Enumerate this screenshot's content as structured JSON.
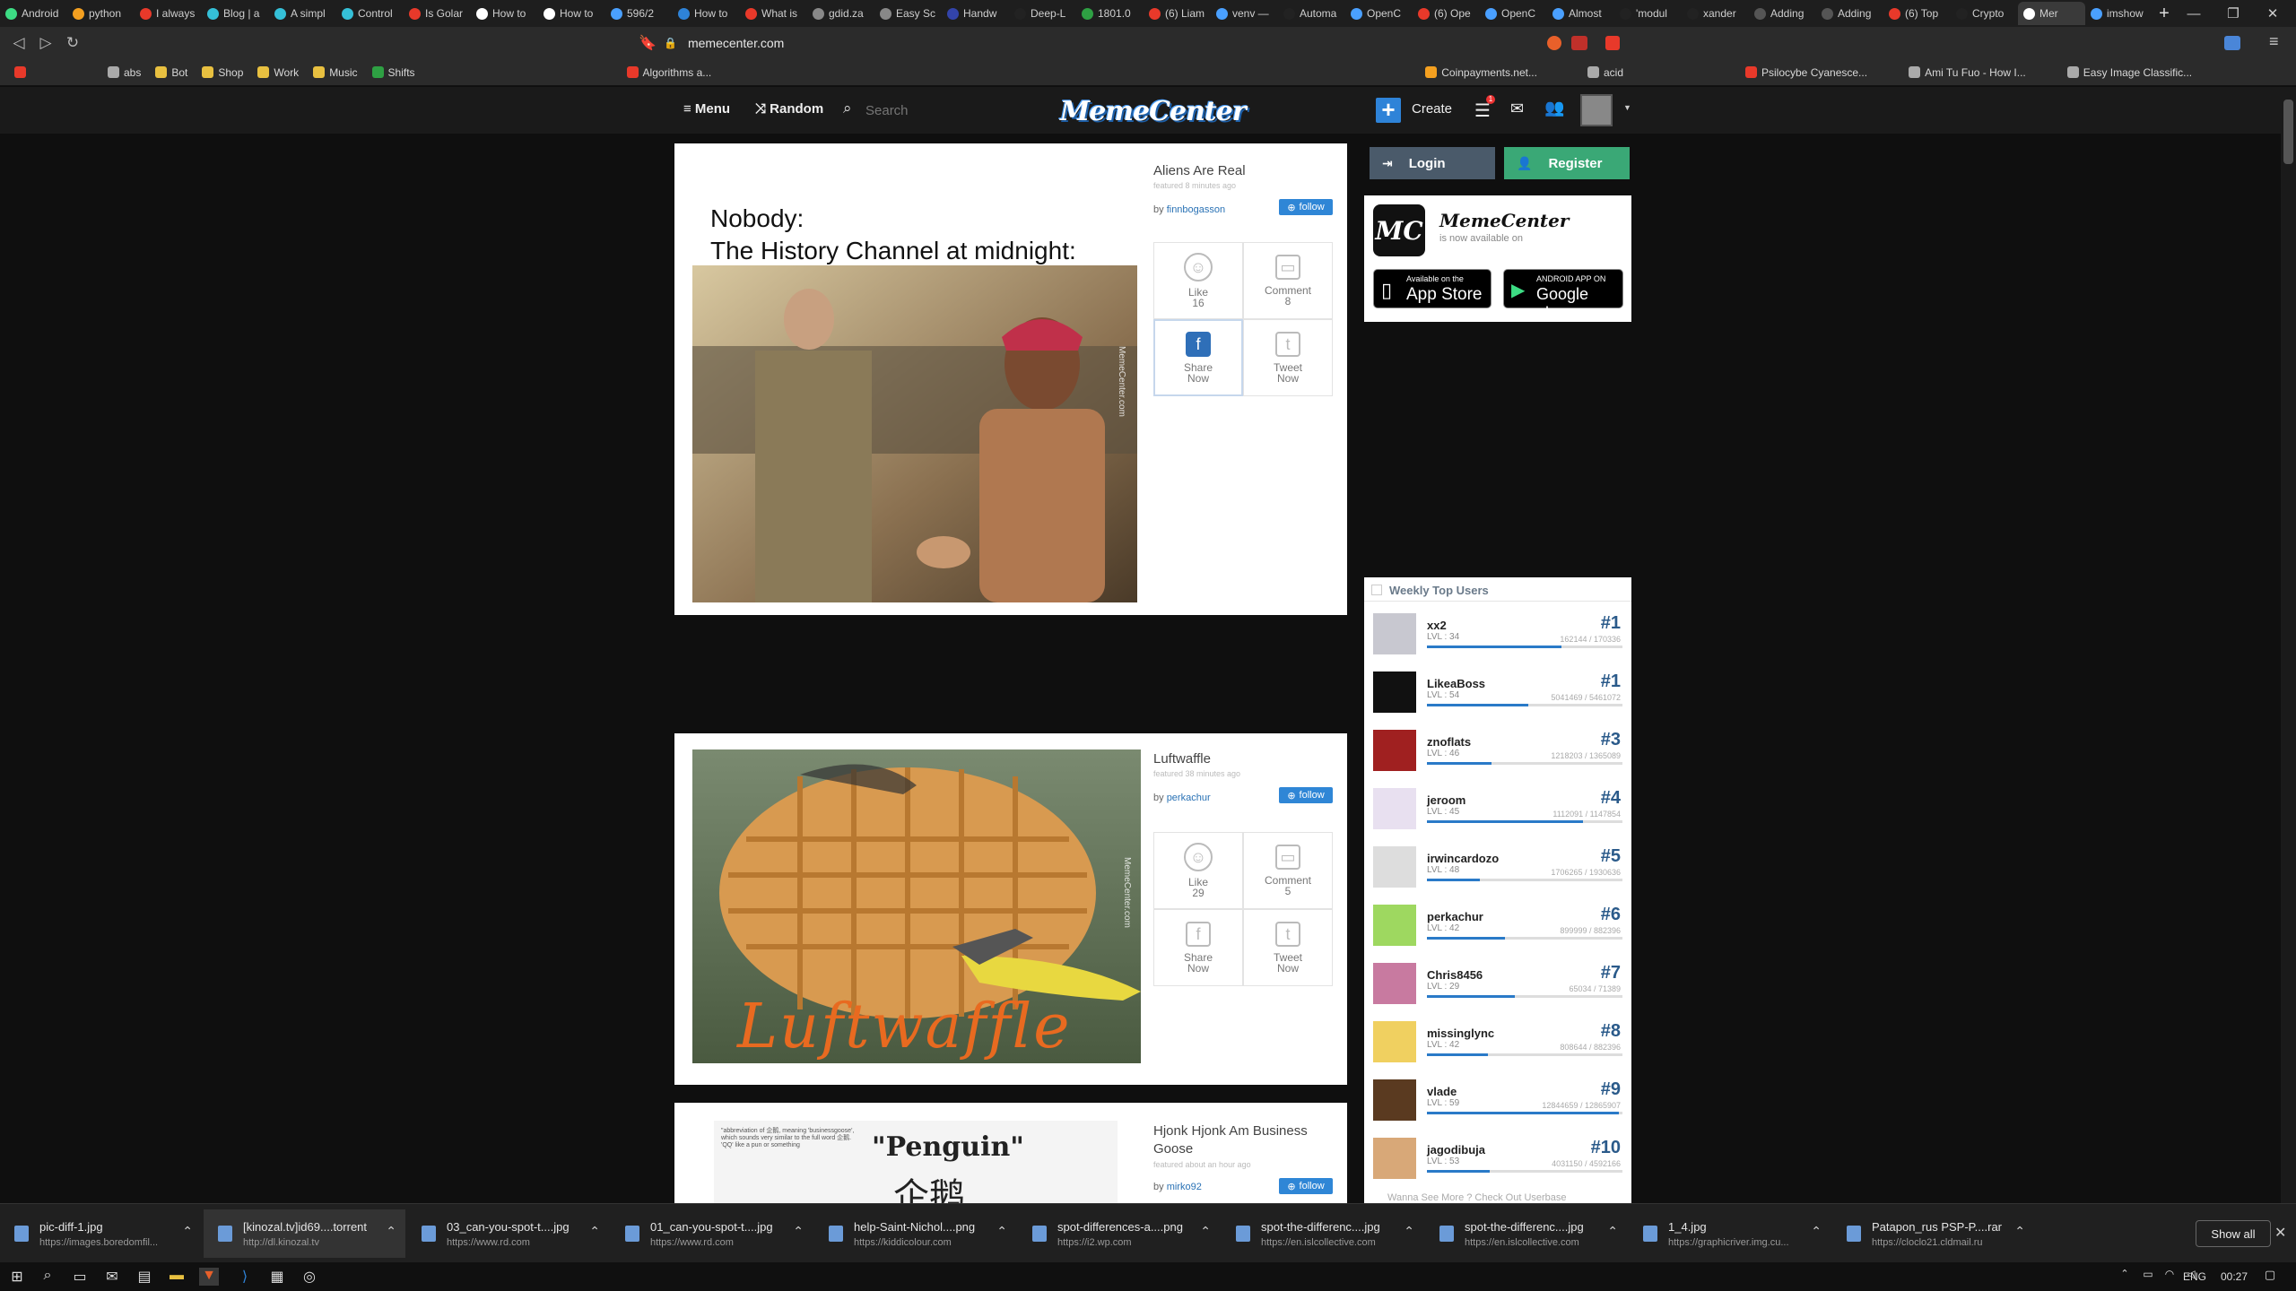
{
  "browser": {
    "tabs": [
      {
        "label": "Android",
        "color": "#3ddc84"
      },
      {
        "label": "python",
        "color": "#f4a020"
      },
      {
        "label": "I always",
        "color": "#e8392a"
      },
      {
        "label": "Blog | a",
        "color": "#35c0d8"
      },
      {
        "label": "A simpl",
        "color": "#35c0d8"
      },
      {
        "label": "Control",
        "color": "#35c0d8"
      },
      {
        "label": "Is Golar",
        "color": "#e8392a"
      },
      {
        "label": "How to",
        "color": "#ffffff"
      },
      {
        "label": "How to",
        "color": "#ffffff"
      },
      {
        "label": "596/2",
        "color": "#4aa0ff"
      },
      {
        "label": "How to",
        "color": "#2e83d8"
      },
      {
        "label": "What is",
        "color": "#e8392a"
      },
      {
        "label": "gdid.za",
        "color": "#888888"
      },
      {
        "label": "Easy Sc",
        "color": "#888888"
      },
      {
        "label": "Handw",
        "color": "#3344aa"
      },
      {
        "label": "Deep-L",
        "color": "#222222"
      },
      {
        "label": "1801.0",
        "color": "#2ea043"
      },
      {
        "label": "(6) Liam",
        "color": "#e8392a"
      },
      {
        "label": "venv —",
        "color": "#4aa0ff"
      },
      {
        "label": "Automa",
        "color": "#222222"
      },
      {
        "label": "OpenC",
        "color": "#4aa0ff"
      },
      {
        "label": "(6) Ope",
        "color": "#e8392a"
      },
      {
        "label": "OpenC",
        "color": "#4aa0ff"
      },
      {
        "label": "Almost",
        "color": "#4aa0ff"
      },
      {
        "label": "'modul",
        "color": "#222222"
      },
      {
        "label": "xander",
        "color": "#222222"
      },
      {
        "label": "Adding",
        "color": "#555555"
      },
      {
        "label": "Adding",
        "color": "#555555"
      },
      {
        "label": "(6) Top",
        "color": "#e8392a"
      },
      {
        "label": "Crypto",
        "color": "#222222"
      },
      {
        "label": "Mer",
        "color": "#ffffff"
      },
      {
        "label": "imshow",
        "color": "#4aa0ff"
      }
    ],
    "active_tab_index": 30,
    "url": "memecenter.com",
    "bookmarks": [
      {
        "label": "abs",
        "color": "#aaaaaa"
      },
      {
        "label": "Bot",
        "color": "#e8c040"
      },
      {
        "label": "Shop",
        "color": "#e8c040"
      },
      {
        "label": "Work",
        "color": "#e8c040"
      },
      {
        "label": "Music",
        "color": "#e8c040"
      },
      {
        "label": "Shifts",
        "color": "#2ea043"
      },
      {
        "label": "Algorithms a...",
        "color": "#e8392a"
      },
      {
        "label": "Coinpayments.net...",
        "color": "#f4a020"
      },
      {
        "label": "acid",
        "color": "#aaaaaa"
      },
      {
        "label": "Psilocybe Cyanesce...",
        "color": "#e8392a"
      },
      {
        "label": "Ami Tu Fuo - How I...",
        "color": "#aaaaaa"
      },
      {
        "label": "Easy Image Classific...",
        "color": "#aaaaaa"
      }
    ]
  },
  "site": {
    "menu_label": "Menu",
    "random_label": "Random",
    "search_placeholder": "Search",
    "logo_text": "MemeCenter",
    "create_label": "Create",
    "notification_count": "1"
  },
  "posts": [
    {
      "title": "Aliens Are Real",
      "featured": "featured 8 minutes ago",
      "by_label": "by",
      "author": "finnbogasson",
      "follow_label": "follow",
      "caption_line1": "Nobody:",
      "caption_line2": "The History Channel at midnight:",
      "watermark": "MemeCenter.com",
      "like_label": "Like",
      "like_count": "16",
      "comment_label": "Comment",
      "comment_count": "8",
      "share_label": "Share",
      "share_sub": "Now",
      "tweet_label": "Tweet",
      "tweet_sub": "Now"
    },
    {
      "title": "Luftwaffle",
      "featured": "featured 38 minutes ago",
      "by_label": "by",
      "author": "perkachur",
      "follow_label": "follow",
      "image_text": "Luftwaffle",
      "watermark": "MemeCenter.com",
      "like_label": "Like",
      "like_count": "29",
      "comment_label": "Comment",
      "comment_count": "5",
      "share_label": "Share",
      "share_sub": "Now",
      "tweet_label": "Tweet",
      "tweet_sub": "Now"
    },
    {
      "title": "Hjonk Hjonk Am Business Goose",
      "featured": "featured about an hour ago",
      "by_label": "by",
      "author": "mirko92",
      "follow_label": "follow",
      "image_text": "\"Penguin\"",
      "image_text_cn": "企鹅",
      "image_small": "\"abbreviation of 企鹅, meaning 'businessgoose', which sounds very similar to the full word 企鹅. 'QQ' like a pun or something"
    }
  ],
  "sidebar": {
    "login_label": "Login",
    "register_label": "Register",
    "app_title": "MemeCenter",
    "app_sub": "is now available on",
    "appstore_small": "Available on the",
    "appstore_big": "App Store",
    "play_small": "ANDROID APP ON",
    "play_big": "Google play",
    "weekly_title": "Weekly Top Users",
    "see_more": "Wanna See More ? Check Out Userbase",
    "users": [
      {
        "name": "xx2",
        "level": "LVL : 34",
        "rank": "#1",
        "xp": "162144 / 170336",
        "progress": 0.69,
        "avatar": "#c8c8d0"
      },
      {
        "name": "LikeaBoss",
        "level": "LVL : 54",
        "rank": "#1",
        "xp": "5041469 / 5461072",
        "progress": 0.52,
        "avatar": "#111111"
      },
      {
        "name": "znoflats",
        "level": "LVL : 46",
        "rank": "#3",
        "xp": "1218203 / 1365089",
        "progress": 0.33,
        "avatar": "#a02020"
      },
      {
        "name": "jeroom",
        "level": "LVL : 45",
        "rank": "#4",
        "xp": "1112091 / 1147854",
        "progress": 0.8,
        "avatar": "#e8e0f0"
      },
      {
        "name": "irwincardozo",
        "level": "LVL : 48",
        "rank": "#5",
        "xp": "1706265 / 1930636",
        "progress": 0.27,
        "avatar": "#dddddd"
      },
      {
        "name": "perkachur",
        "level": "LVL : 42",
        "rank": "#6",
        "xp": "899999 / 882396",
        "progress": 0.4,
        "avatar": "#9ed860"
      },
      {
        "name": "Chris8456",
        "level": "LVL : 29",
        "rank": "#7",
        "xp": "65034 / 71389",
        "progress": 0.45,
        "avatar": "#c87aa0"
      },
      {
        "name": "missinglync",
        "level": "LVL : 42",
        "rank": "#8",
        "xp": "808644 / 882396",
        "progress": 0.31,
        "avatar": "#f0d060"
      },
      {
        "name": "vlade",
        "level": "LVL : 59",
        "rank": "#9",
        "xp": "12844659 / 12865907",
        "progress": 0.98,
        "avatar": "#5a3a20"
      },
      {
        "name": "jagodibuja",
        "level": "LVL : 53",
        "rank": "#10",
        "xp": "4031150 / 4592166",
        "progress": 0.32,
        "avatar": "#d8a878"
      }
    ]
  },
  "downloads": {
    "items": [
      {
        "name": "pic-diff-1.jpg",
        "src": "https://images.boredomfil..."
      },
      {
        "name": "[kinozal.tv]id69....torrent",
        "src": "http://dl.kinozal.tv"
      },
      {
        "name": "03_can-you-spot-t....jpg",
        "src": "https://www.rd.com"
      },
      {
        "name": "01_can-you-spot-t....jpg",
        "src": "https://www.rd.com"
      },
      {
        "name": "help-Saint-Nichol....png",
        "src": "https://kiddicolour.com"
      },
      {
        "name": "spot-differences-a....png",
        "src": "https://i2.wp.com"
      },
      {
        "name": "spot-the-differenc....jpg",
        "src": "https://en.islcollective.com"
      },
      {
        "name": "spot-the-differenc....jpg",
        "src": "https://en.islcollective.com"
      },
      {
        "name": "1_4.jpg",
        "src": "https://graphicriver.img.cu..."
      },
      {
        "name": "Patapon_rus PSP-P....rar",
        "src": "https://cloclo21.cldmail.ru"
      }
    ],
    "show_all_label": "Show all"
  },
  "taskbar": {
    "lang": "ENG",
    "time": "00:27"
  }
}
